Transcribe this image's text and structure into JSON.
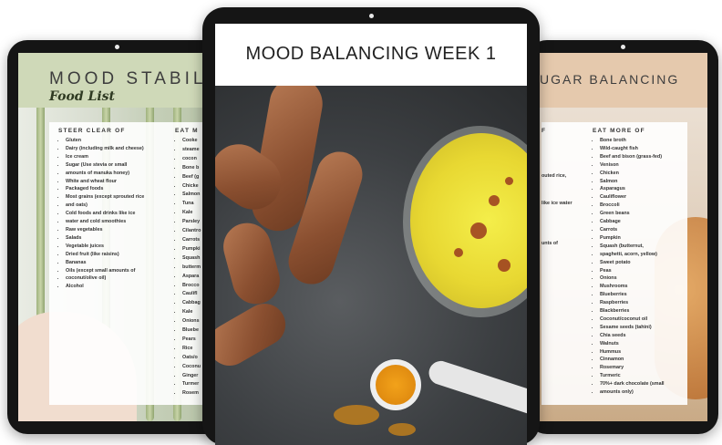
{
  "center": {
    "title": "MOOD BALANCING WEEK 1"
  },
  "left": {
    "title": "MOOD STABIL",
    "subtitle": "Food List",
    "steer_clear_heading": "STEER CLEAR OF",
    "eat_more_heading": "EAT M",
    "steer_clear_items": [
      "Gluten",
      "Dairy (including milk and cheese)",
      "Ice cream",
      "Sugar (Use stevia or small",
      "amounts of manuka honey)",
      "White and wheat flour",
      "Packaged foods",
      "Most grains (except sprouted rice",
      "and oats)",
      "Cold foods and drinks like ice",
      "water and cold smoothies",
      "Raw vegetables",
      "Salads",
      "Vegetable juices",
      "Dried fruit (like raisins)",
      "Bananas",
      "Oils (except small amounts of",
      "coconut/olive oil)",
      "Alcohol"
    ],
    "eat_more_items": [
      "Cooke",
      "steame",
      "cocon",
      "Bone b",
      "Beef (g",
      "Chicke",
      "Salmon",
      "Tuna",
      "Kale",
      "Parsley",
      "Cilantro",
      "Carrots",
      "Pumpki",
      "Squash",
      "butterm",
      "Aspara",
      "Brocco",
      "Caulifl",
      "Cabbag",
      "Kale",
      "Onions",
      "Bluebe",
      "Pears",
      "Rice",
      "Oats/o",
      "Coconu",
      "Ginger",
      "Turmer",
      "Rosem"
    ]
  },
  "right": {
    "title": "UGAR BALANCING",
    "left_heading": "F",
    "eat_more_heading": "EAT MORE OF",
    "left_fragments": [
      "outed rice,",
      "like ice water",
      "unts of"
    ],
    "eat_more_items": [
      "Bone broth",
      "Wild-caught fish",
      "Beef and bison (grass-fed)",
      "Venison",
      "Chicken",
      "Salmon",
      "Asparagus",
      "Cauliflower",
      "Broccoli",
      "Green beans",
      "Cabbage",
      "Carrots",
      "Pumpkin",
      "Squash (butternut,",
      "spaghetti, acorn, yellow)",
      "Sweet potato",
      "Peas",
      "Onions",
      "Mushrooms",
      "Blueberries",
      "Raspberries",
      "Blackberries",
      "Coconut/coconut oil",
      "Sesame seeds (tahini)",
      "Chia seeds",
      "Walnuts",
      "Hummus",
      "Cinnamon",
      "Rosemary",
      "Turmeric",
      "70%+ dark chocolate (small",
      "amounts only)"
    ]
  }
}
